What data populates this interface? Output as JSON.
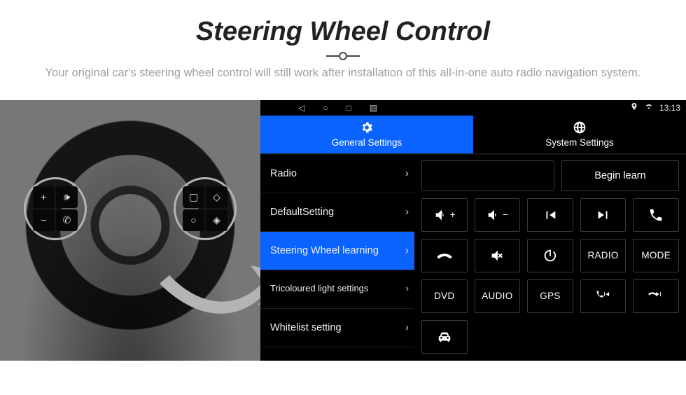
{
  "hero": {
    "title": "Steering Wheel Control",
    "subtitle": "Your original car's steering wheel control will still work after installation of this all-in-one auto radio navigation system."
  },
  "statusbar": {
    "time": "13:13",
    "icons": {
      "back": "◁",
      "home": "○",
      "recents": "□",
      "more": "▤",
      "gps": "📍",
      "wifi": "📶"
    }
  },
  "tabs": {
    "general": "General Settings",
    "system": "System Settings"
  },
  "menu": [
    {
      "label": "Radio",
      "selected": false
    },
    {
      "label": "DefaultSetting",
      "selected": false
    },
    {
      "label": "Steering Wheel learning",
      "selected": true
    },
    {
      "label": "Tricoloured light settings",
      "selected": false
    },
    {
      "label": "Whitelist setting",
      "selected": false
    }
  ],
  "panel": {
    "begin": "Begin learn",
    "buttons": [
      {
        "kind": "icon",
        "name": "vol-up-icon"
      },
      {
        "kind": "icon",
        "name": "vol-down-icon"
      },
      {
        "kind": "icon",
        "name": "prev-track-icon"
      },
      {
        "kind": "icon",
        "name": "next-track-icon"
      },
      {
        "kind": "icon",
        "name": "phone-pickup-icon"
      },
      {
        "kind": "icon",
        "name": "phone-hangup-icon"
      },
      {
        "kind": "icon",
        "name": "mute-icon"
      },
      {
        "kind": "icon",
        "name": "power-icon"
      },
      {
        "kind": "text",
        "label": "RADIO"
      },
      {
        "kind": "text",
        "label": "MODE"
      },
      {
        "kind": "text",
        "label": "DVD"
      },
      {
        "kind": "text",
        "label": "AUDIO"
      },
      {
        "kind": "text",
        "label": "GPS"
      },
      {
        "kind": "icon",
        "name": "phone-prev-icon"
      },
      {
        "kind": "icon",
        "name": "phone-next-icon"
      },
      {
        "kind": "icon",
        "name": "car-icon"
      }
    ]
  },
  "wheel": {
    "left_buttons": [
      "+",
      "🕪",
      "−",
      "✆"
    ],
    "right_buttons": [
      "▢",
      "◇",
      "○",
      "◈"
    ]
  }
}
